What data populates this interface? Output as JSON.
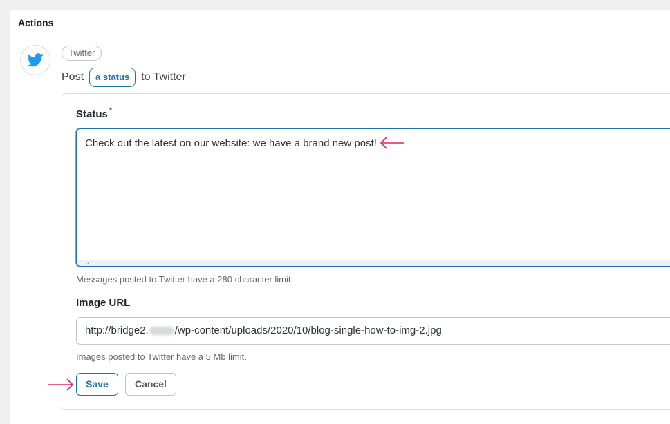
{
  "section": {
    "title": "Actions"
  },
  "action": {
    "service_icon": "twitter-bird-icon",
    "service_label": "Twitter",
    "sentence_prefix": "Post",
    "sentence_variable": "a status",
    "sentence_suffix": "to Twitter"
  },
  "form": {
    "status": {
      "label": "Status",
      "required_mark": "*",
      "value": "Check out the latest on our website: we have a brand new post!",
      "help": "Messages posted to Twitter have a 280 character limit."
    },
    "image_url": {
      "label": "Image URL",
      "value_prefix": "http://bridge2.",
      "value_suffix": "/wp-content/uploads/2020/10/blog-single-how-to-img-2.jpg",
      "help": "Images posted to Twitter have a 5 Mb limit."
    },
    "save_label": "Save",
    "cancel_label": "Cancel"
  },
  "annotations": {
    "arrow_color": "#e0245e"
  },
  "colors": {
    "accent": "#2271b1",
    "twitter_blue": "#1d9bf0"
  }
}
